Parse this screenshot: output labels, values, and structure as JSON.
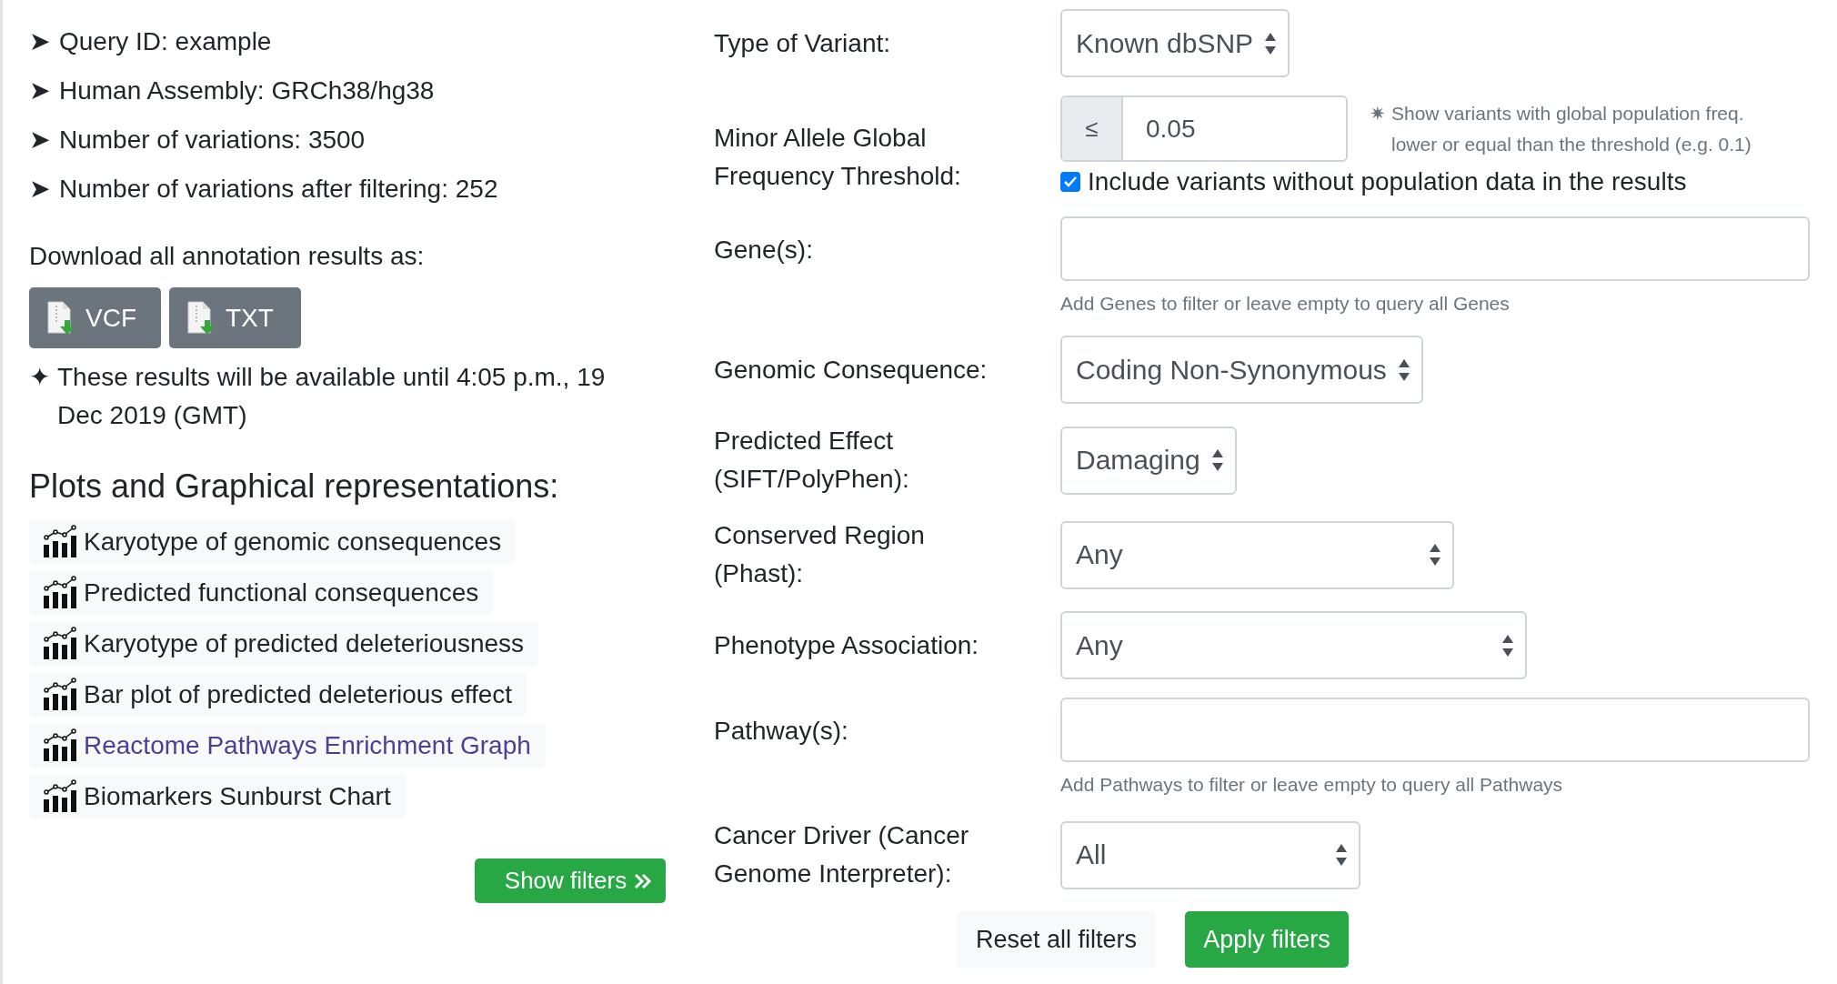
{
  "summary": [
    {
      "bullet": "➤",
      "text": "Query ID: example"
    },
    {
      "bullet": "➤",
      "text": "Human Assembly: GRCh38/hg38"
    },
    {
      "bullet": "➤",
      "text": "Number of variations: 3500"
    },
    {
      "bullet": "➤",
      "text": "Number of variations after filtering: 252"
    }
  ],
  "download": {
    "label": "Download all annotation results as:",
    "buttons": [
      "VCF",
      "TXT"
    ]
  },
  "availability": {
    "icon": "✦",
    "text": "These results will be available until 4:05 p.m., 19 Dec 2019 (GMT)"
  },
  "plots": {
    "heading": "Plots and Graphical representations:",
    "items": [
      {
        "label": "Karyotype of genomic consequences",
        "visited": false
      },
      {
        "label": "Predicted functional consequences",
        "visited": false
      },
      {
        "label": "Karyotype of predicted deleteriousness",
        "visited": false
      },
      {
        "label": "Bar plot of predicted deleterious effect",
        "visited": false
      },
      {
        "label": "Reactome Pathways Enrichment Graph",
        "visited": true
      },
      {
        "label": "Biomarkers Sunburst Chart",
        "visited": false
      }
    ]
  },
  "show_filters_button": "Show filters",
  "filters": [
    {
      "kind": "select",
      "label": "Type of Variant:",
      "value": "Known dbSNP"
    },
    {
      "kind": "threshold",
      "label": "Minor Allele Global Frequency Threshold:",
      "prefix": "≤",
      "value": "0.05",
      "hint_icon": "✷",
      "hint": "Show variants with global population freq. lower or equal than the threshold (e.g. 0.1)",
      "checkbox": {
        "label": "Include variants without population data in the results",
        "checked": true
      }
    },
    {
      "kind": "text",
      "label": "Gene(s):",
      "help": "Add Genes to filter or leave empty to query all Genes"
    },
    {
      "kind": "select",
      "label": "Genomic Consequence:",
      "value": "Coding Non-Synonymous"
    },
    {
      "kind": "select",
      "label": "Predicted Effect (SIFT/PolyPhen):",
      "value": "Damaging"
    },
    {
      "kind": "select",
      "label": "Conserved Region (Phast):",
      "value": "Any"
    },
    {
      "kind": "select",
      "label": "Phenotype Association:",
      "value": "Any"
    },
    {
      "kind": "text",
      "label": "Pathway(s):",
      "help": "Add Pathways to filter or leave empty to query all Pathways"
    },
    {
      "kind": "select",
      "label": "Cancer Driver (Cancer Genome Interpreter):",
      "value": "All"
    }
  ],
  "buttons": [
    {
      "kind": "secondary",
      "label": "Reset all filters"
    },
    {
      "kind": "primary",
      "label": "Apply filters"
    }
  ]
}
